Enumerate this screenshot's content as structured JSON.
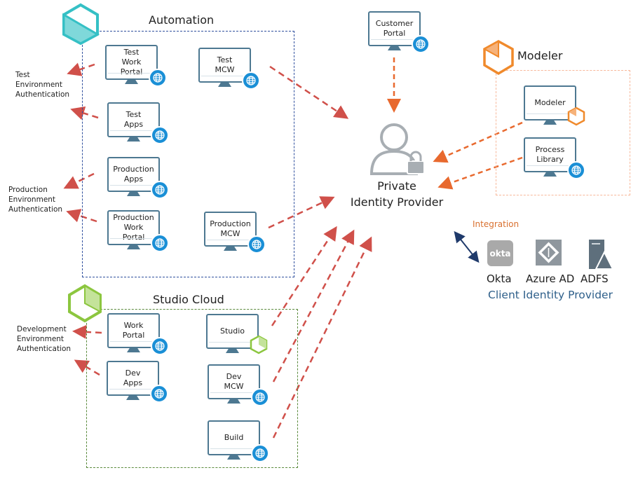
{
  "groups": {
    "automation": {
      "title": "Automation",
      "color": "#2f4f9e",
      "icon": "automation-hexagon-icon"
    },
    "modeler": {
      "title": "Modeler",
      "color": "#f7b89a",
      "icon": "modeler-hexagon-icon"
    },
    "studio_cloud": {
      "title": "Studio Cloud",
      "color": "#5a8a3c",
      "icon": "studio-hexagon-icon"
    }
  },
  "monitors": [
    {
      "label": "Test\nWork\nPortal",
      "badge": "globe-icon"
    },
    {
      "label": "Test\nMCW",
      "badge": "globe-icon"
    },
    {
      "label": "Test\nApps",
      "badge": "globe-icon"
    },
    {
      "label": "Production\nApps",
      "badge": "globe-icon"
    },
    {
      "label": "Production\nWork\nPortal",
      "badge": "globe-icon"
    },
    {
      "label": "Production\nMCW",
      "badge": "globe-icon"
    },
    {
      "label": "Customer\nPortal",
      "badge": "globe-icon"
    },
    {
      "label": "Modeler",
      "badge": "modeler-hexagon-icon"
    },
    {
      "label": "Process\nLibrary",
      "badge": "globe-icon"
    },
    {
      "label": "Work\nPortal",
      "badge": "globe-icon"
    },
    {
      "label": "Dev\nApps",
      "badge": "globe-icon"
    },
    {
      "label": "Studio",
      "badge": "studio-hexagon-icon"
    },
    {
      "label": "Dev\nMCW",
      "badge": "globe-icon"
    },
    {
      "label": "Build",
      "badge": "globe-icon"
    }
  ],
  "side_labels": {
    "test": "Test\nEnvironment\nAuthentication",
    "production": "Production\nEnvironment\nAuthentication",
    "development": "Development\nEnvironment\nAuthentication"
  },
  "identity_provider": {
    "label": "Private\nIdentity Provider",
    "icon": "user-lock-icon"
  },
  "integration": {
    "label": "Integration",
    "color": "#d9702f"
  },
  "client_providers": {
    "title": "Client Identity Provider",
    "title_color": "#2e5f8a",
    "items": [
      {
        "label": "Okta",
        "logo_text": "okta"
      },
      {
        "label": "Azure AD"
      },
      {
        "label": "ADFS"
      }
    ]
  },
  "colors": {
    "arrow_red": "#d0504a",
    "arrow_orange": "#e8692e",
    "monitor": "#4d7891",
    "globe": "#1a8fd6"
  }
}
